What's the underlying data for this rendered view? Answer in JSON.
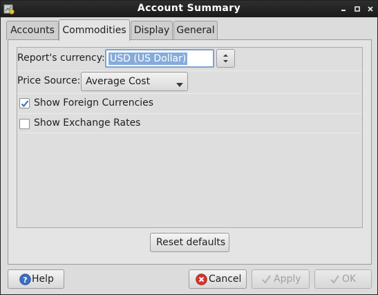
{
  "window": {
    "title": "Account Summary"
  },
  "tabs": [
    {
      "label": "Accounts",
      "active": false
    },
    {
      "label": "Commodities",
      "active": true
    },
    {
      "label": "Display",
      "active": false
    },
    {
      "label": "General",
      "active": false
    }
  ],
  "options": {
    "currency_label": "Report's currency:",
    "currency_value": "USD (US Dollar)",
    "price_source_label": "Price Source:",
    "price_source_value": "Average Cost",
    "show_foreign_label": "Show Foreign Currencies",
    "show_foreign_checked": true,
    "show_exchange_label": "Show Exchange Rates",
    "show_exchange_checked": false
  },
  "buttons": {
    "reset": "Reset defaults",
    "help": "Help",
    "cancel": "Cancel",
    "apply": "Apply",
    "ok": "OK"
  },
  "colors": {
    "selection": "#86abd9",
    "titlebar": "#1f1f1f",
    "cancel_icon": "#d9342b",
    "help_icon": "#3b6fc4"
  }
}
